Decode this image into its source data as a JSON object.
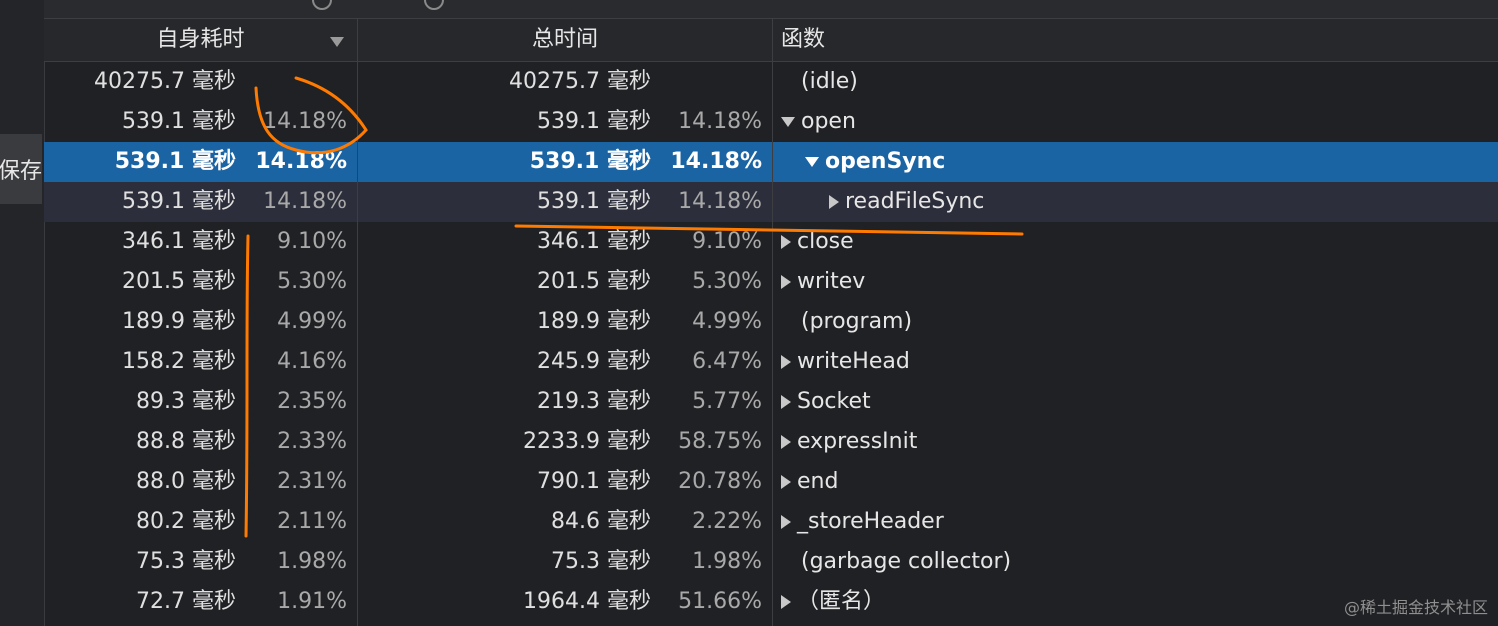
{
  "sidebar": {
    "save_label": "保存"
  },
  "toolbar": {
    "partial_text": ""
  },
  "columns": {
    "self_time": "自身耗时",
    "total_time": "总时间",
    "function": "函数"
  },
  "rows": [
    {
      "self_ms": "40275.7 毫秒",
      "self_pct": "",
      "total_ms": "40275.7 毫秒",
      "total_pct": "",
      "func": "(idle)",
      "expander": "none",
      "indent": 0
    },
    {
      "self_ms": "539.1 毫秒",
      "self_pct": "14.18%",
      "total_ms": "539.1 毫秒",
      "total_pct": "14.18%",
      "func": "open",
      "expander": "expanded",
      "indent": 0
    },
    {
      "self_ms": "539.1 毫秒",
      "self_pct": "14.18%",
      "total_ms": "539.1 毫秒",
      "total_pct": "14.18%",
      "func": "openSync",
      "expander": "expanded",
      "indent": 1,
      "selected": true
    },
    {
      "self_ms": "539.1 毫秒",
      "self_pct": "14.18%",
      "total_ms": "539.1 毫秒",
      "total_pct": "14.18%",
      "func": "readFileSync",
      "expander": "collapsed",
      "indent": 2,
      "hover": true
    },
    {
      "self_ms": "346.1 毫秒",
      "self_pct": "9.10%",
      "total_ms": "346.1 毫秒",
      "total_pct": "9.10%",
      "func": "close",
      "expander": "collapsed",
      "indent": 0
    },
    {
      "self_ms": "201.5 毫秒",
      "self_pct": "5.30%",
      "total_ms": "201.5 毫秒",
      "total_pct": "5.30%",
      "func": "writev",
      "expander": "collapsed",
      "indent": 0
    },
    {
      "self_ms": "189.9 毫秒",
      "self_pct": "4.99%",
      "total_ms": "189.9 毫秒",
      "total_pct": "4.99%",
      "func": "(program)",
      "expander": "none",
      "indent": 0
    },
    {
      "self_ms": "158.2 毫秒",
      "self_pct": "4.16%",
      "total_ms": "245.9 毫秒",
      "total_pct": "6.47%",
      "func": "writeHead",
      "expander": "collapsed",
      "indent": 0
    },
    {
      "self_ms": "89.3 毫秒",
      "self_pct": "2.35%",
      "total_ms": "219.3 毫秒",
      "total_pct": "5.77%",
      "func": "Socket",
      "expander": "collapsed",
      "indent": 0
    },
    {
      "self_ms": "88.8 毫秒",
      "self_pct": "2.33%",
      "total_ms": "2233.9 毫秒",
      "total_pct": "58.75%",
      "func": "expressInit",
      "expander": "collapsed",
      "indent": 0
    },
    {
      "self_ms": "88.0 毫秒",
      "self_pct": "2.31%",
      "total_ms": "790.1 毫秒",
      "total_pct": "20.78%",
      "func": "end",
      "expander": "collapsed",
      "indent": 0
    },
    {
      "self_ms": "80.2 毫秒",
      "self_pct": "2.11%",
      "total_ms": "84.6 毫秒",
      "total_pct": "2.22%",
      "func": "_storeHeader",
      "expander": "collapsed",
      "indent": 0
    },
    {
      "self_ms": "75.3 毫秒",
      "self_pct": "1.98%",
      "total_ms": "75.3 毫秒",
      "total_pct": "1.98%",
      "func": "(garbage collector)",
      "expander": "none",
      "indent": 0
    },
    {
      "self_ms": "72.7 毫秒",
      "self_pct": "1.91%",
      "total_ms": "1964.4 毫秒",
      "total_pct": "51.66%",
      "func": "（匿名）",
      "expander": "collapsed",
      "indent": 0
    }
  ],
  "watermark": "@稀土掘金技术社区",
  "colors": {
    "selected_row": "#1b64a3",
    "annotation": "#ff7a00",
    "background": "#202124"
  }
}
